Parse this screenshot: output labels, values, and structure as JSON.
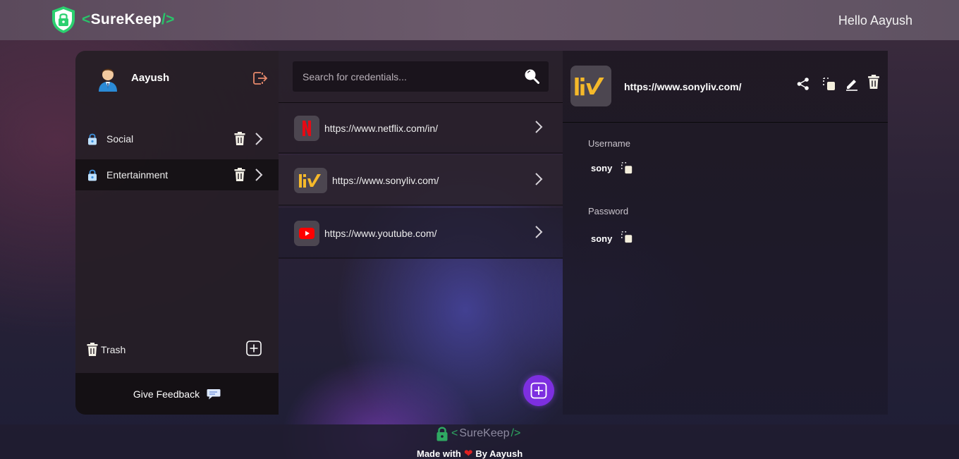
{
  "header": {
    "brand_open": "<",
    "brand_name": "SureKeep",
    "brand_close": "/>",
    "greeting": "Hello Aayush"
  },
  "sidebar": {
    "user_name": "Aayush",
    "folders": [
      {
        "label": "Social",
        "icon": "lock-icon",
        "active": false
      },
      {
        "label": "Entertainment",
        "icon": "lock-icon",
        "active": true
      }
    ],
    "trash_label": "Trash",
    "feedback_label": "Give Feedback"
  },
  "search": {
    "placeholder": "Search for credentials..."
  },
  "credentials": [
    {
      "url": "https://www.netflix.com/in/",
      "logo": "netflix-logo"
    },
    {
      "url": "https://www.sonyliv.com/",
      "logo": "sonyliv-logo"
    },
    {
      "url": "https://www.youtube.com/",
      "logo": "youtube-logo"
    }
  ],
  "detail": {
    "url": "https://www.sonyliv.com/",
    "username_label": "Username",
    "username_value": "sony",
    "password_label": "Password",
    "password_value": "sony"
  },
  "footer": {
    "brand_open": "<",
    "brand_name": "SureKeep",
    "brand_close": "/>",
    "made_with": "Made with",
    "by": "By Aayush"
  },
  "colors": {
    "brand_green": "#29c46a",
    "accent_purple": "#7d2fe0",
    "heart_red": "#e02020"
  }
}
